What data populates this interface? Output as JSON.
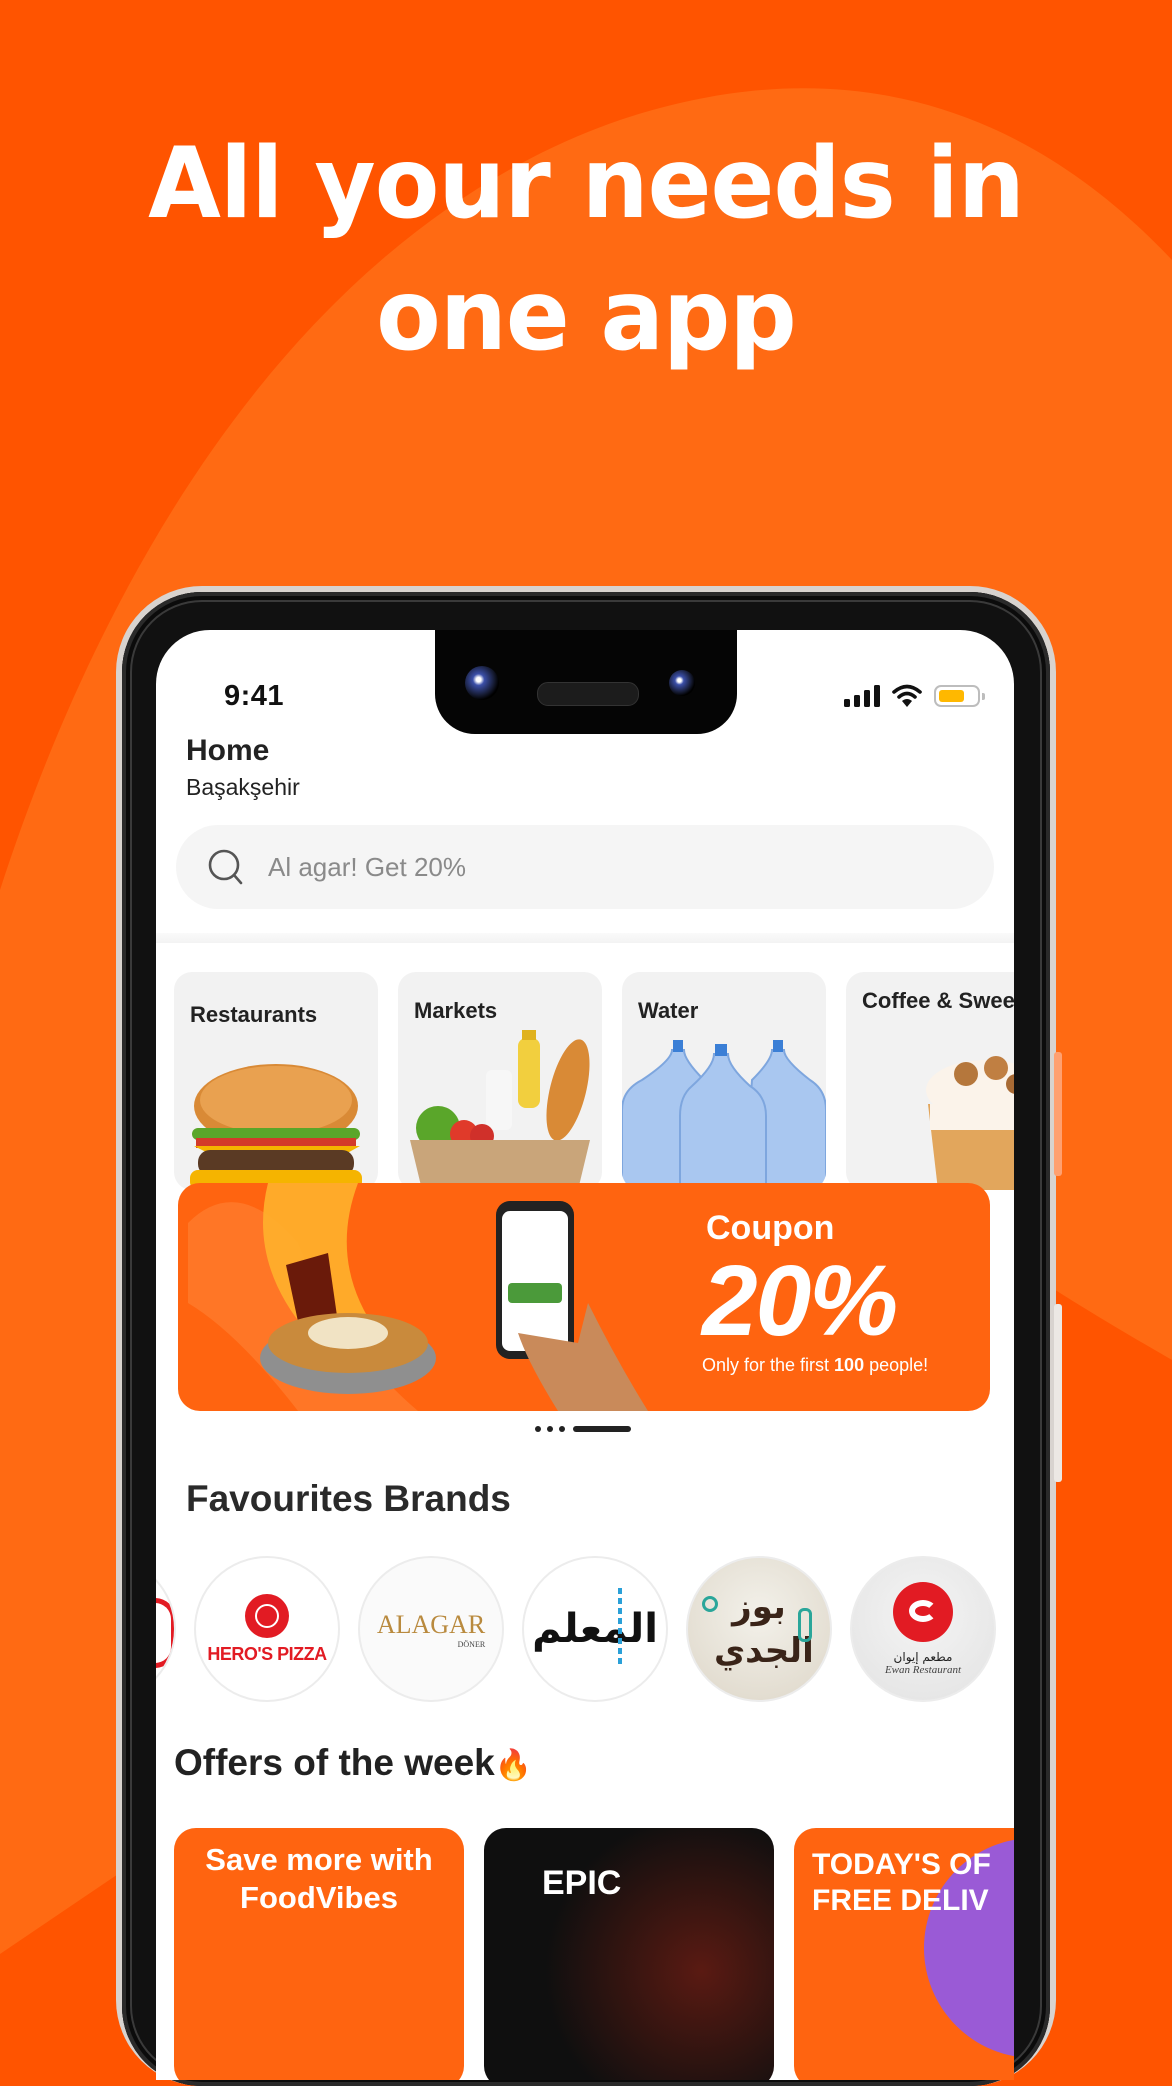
{
  "headline": {
    "line1": "All your needs in",
    "line2": "one app"
  },
  "colors": {
    "background": "#FF5400",
    "wave": "#FF6A13",
    "accent": "#FF6410",
    "battery": "#FFB800",
    "brand_red": "#E21B23"
  },
  "status_bar": {
    "time": "9:41",
    "icons": [
      "signal-icon",
      "wifi-icon",
      "battery-icon"
    ]
  },
  "header": {
    "title": "Home",
    "location": "Başakşehir"
  },
  "search": {
    "placeholder": "Al agar! Get 20%",
    "icon": "search-icon"
  },
  "categories": [
    {
      "label": "Restaurants",
      "icon": "burger-image"
    },
    {
      "label": "Markets",
      "icon": "grocery-bag-image"
    },
    {
      "label": "Water",
      "icon": "water-bottles-image"
    },
    {
      "label": "Coffee & Sweets",
      "icon": "coffee-dessert-image"
    }
  ],
  "promo_banner": {
    "title": "Coupon",
    "discount": "20%",
    "note_prefix": "Only for the first ",
    "note_bold": "100",
    "note_suffix": " people!",
    "carousel_dots": 4,
    "active_dot": 4
  },
  "brands": {
    "title": "Favourites Brands",
    "items": [
      {
        "name": "partial-brand",
        "text": ""
      },
      {
        "name": "Hero's Pizza",
        "text": "HERO'S PIZZA"
      },
      {
        "name": "Alagar Döner",
        "text": "ALAGAR",
        "sub": "DÖNER"
      },
      {
        "name": "Al Muallem",
        "text": "المعلم"
      },
      {
        "name": "Bouz Al Jidi",
        "text": "بوز الجدي"
      },
      {
        "name": "Ewan Restaurant",
        "text": "مطعم إيوان",
        "sub": "Ewan Restaurant"
      }
    ]
  },
  "offers": {
    "title": "Offers of the week",
    "emoji": "🔥",
    "items": [
      {
        "line1": "Save more with",
        "line2": "FoodVibes"
      },
      {
        "line1": "EPIC",
        "line2": ""
      },
      {
        "line1": "TODAY'S OF",
        "line2": "FREE DELIV"
      }
    ]
  }
}
